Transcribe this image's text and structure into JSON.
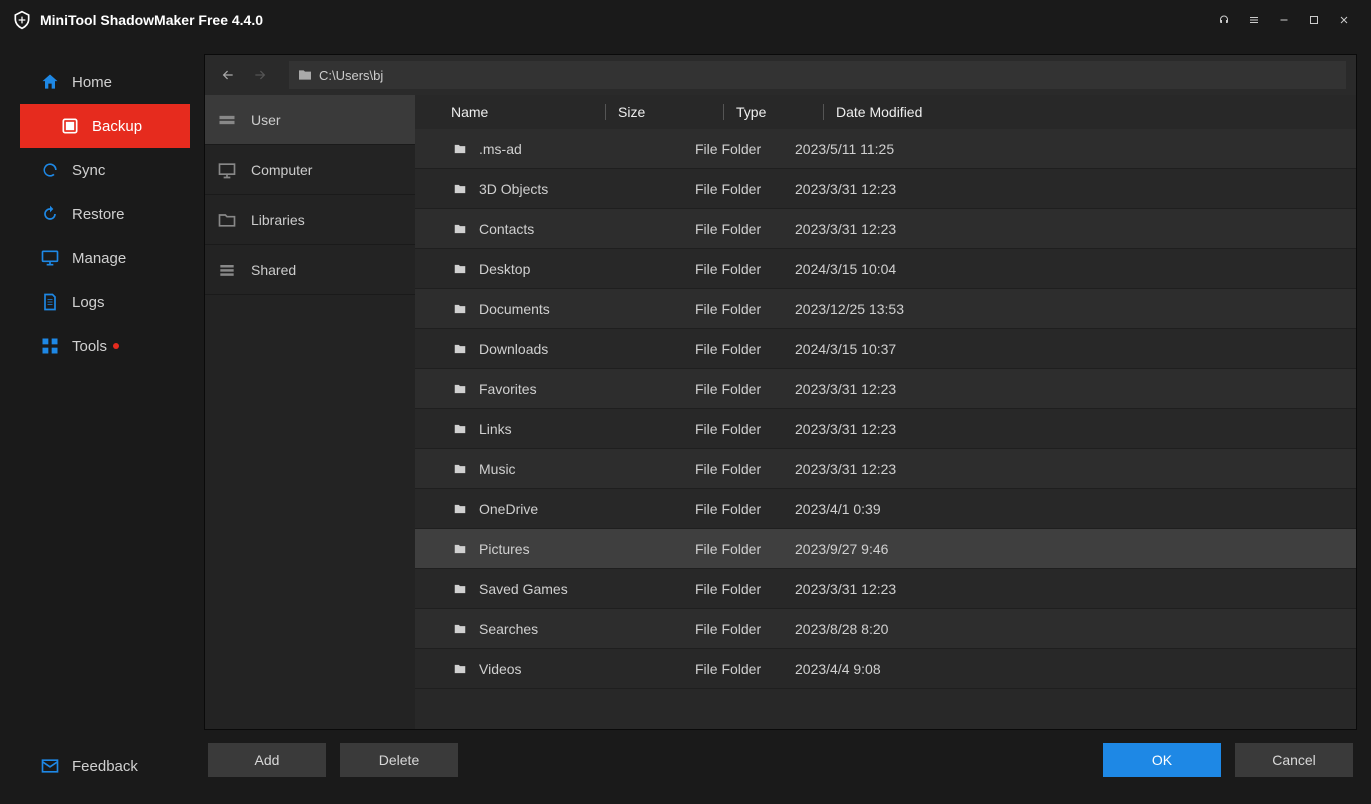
{
  "app": {
    "title": "MiniTool ShadowMaker Free 4.4.0"
  },
  "sidebar": {
    "items": [
      {
        "label": "Home"
      },
      {
        "label": "Backup"
      },
      {
        "label": "Sync"
      },
      {
        "label": "Restore"
      },
      {
        "label": "Manage"
      },
      {
        "label": "Logs"
      },
      {
        "label": "Tools"
      }
    ],
    "feedback": "Feedback"
  },
  "pathbar": {
    "path": "C:\\Users\\bj"
  },
  "sources": [
    {
      "label": "User"
    },
    {
      "label": "Computer"
    },
    {
      "label": "Libraries"
    },
    {
      "label": "Shared"
    }
  ],
  "columns": {
    "name": "Name",
    "size": "Size",
    "type": "Type",
    "date": "Date Modified"
  },
  "files": [
    {
      "name": ".ms-ad",
      "type": "File Folder",
      "date": "2023/5/11 11:25"
    },
    {
      "name": "3D Objects",
      "type": "File Folder",
      "date": "2023/3/31 12:23"
    },
    {
      "name": "Contacts",
      "type": "File Folder",
      "date": "2023/3/31 12:23"
    },
    {
      "name": "Desktop",
      "type": "File Folder",
      "date": "2024/3/15 10:04"
    },
    {
      "name": "Documents",
      "type": "File Folder",
      "date": "2023/12/25 13:53"
    },
    {
      "name": "Downloads",
      "type": "File Folder",
      "date": "2024/3/15 10:37"
    },
    {
      "name": "Favorites",
      "type": "File Folder",
      "date": "2023/3/31 12:23"
    },
    {
      "name": "Links",
      "type": "File Folder",
      "date": "2023/3/31 12:23"
    },
    {
      "name": "Music",
      "type": "File Folder",
      "date": "2023/3/31 12:23"
    },
    {
      "name": "OneDrive",
      "type": "File Folder",
      "date": "2023/4/1 0:39"
    },
    {
      "name": "Pictures",
      "type": "File Folder",
      "date": "2023/9/27 9:46",
      "highlight": true
    },
    {
      "name": "Saved Games",
      "type": "File Folder",
      "date": "2023/3/31 12:23"
    },
    {
      "name": "Searches",
      "type": "File Folder",
      "date": "2023/8/28 8:20"
    },
    {
      "name": "Videos",
      "type": "File Folder",
      "date": "2023/4/4 9:08"
    }
  ],
  "actions": {
    "add": "Add",
    "delete": "Delete",
    "ok": "OK",
    "cancel": "Cancel"
  }
}
